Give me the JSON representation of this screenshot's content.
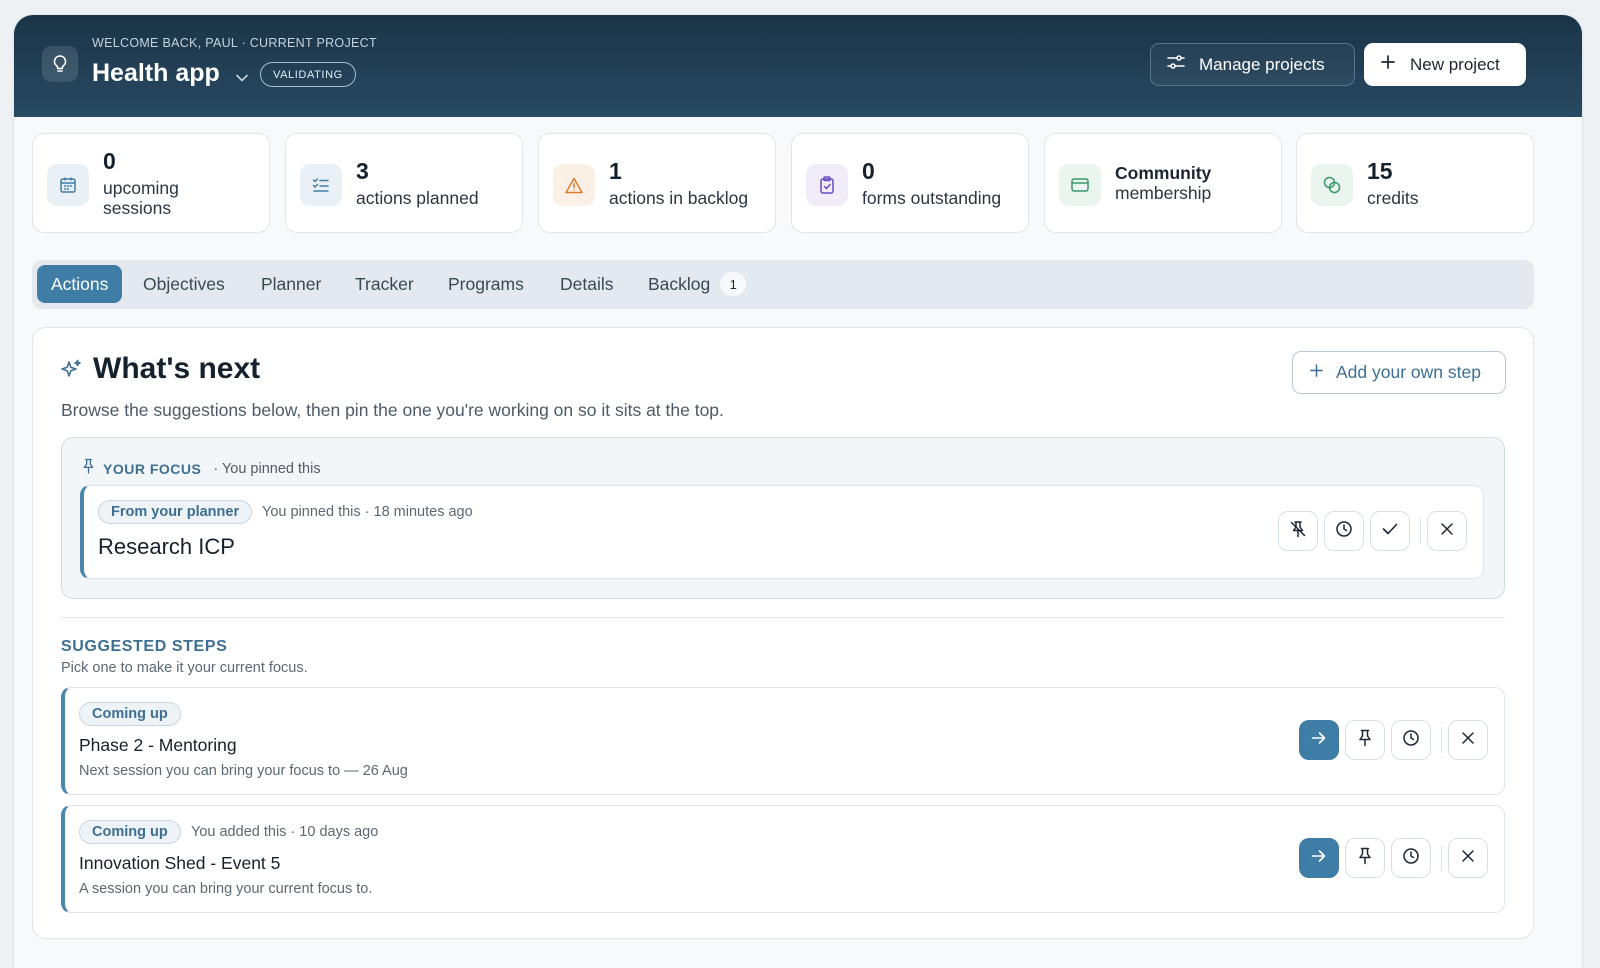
{
  "header": {
    "welcome": "WELCOME BACK, PAUL · CURRENT PROJECT",
    "project_title": "Health app",
    "status": "VALIDATING",
    "manage_label": "Manage projects",
    "new_label": "New project",
    "icons": {
      "project": "lightbulb-icon",
      "chevron": "chevron-down-icon",
      "manage": "sliders-icon",
      "new": "plus-icon"
    }
  },
  "stats": [
    {
      "number": "0",
      "label_line1": "upcoming",
      "label_line2": "sessions",
      "icon": "calendar-icon",
      "color": "#3f7da6"
    },
    {
      "number": "3",
      "label_line1": "actions planned",
      "icon": "checklist-icon",
      "color": "#3f7da6"
    },
    {
      "number": "1",
      "label_line1": "actions in backlog",
      "icon": "warning-icon",
      "color": "#e07b2e"
    },
    {
      "number": "0",
      "label_line1": "forms outstanding",
      "icon": "clipboard-icon",
      "color": "#6a4bc4"
    },
    {
      "label_line1": "Community",
      "label_line2": "membership",
      "icon": "card-icon",
      "color": "#3b9a6a"
    },
    {
      "number": "15",
      "label_line1": "credits",
      "icon": "coins-icon",
      "color": "#3b9a6a"
    }
  ],
  "tabs": [
    {
      "label": "Actions",
      "active": true
    },
    {
      "label": "Objectives"
    },
    {
      "label": "Planner"
    },
    {
      "label": "Tracker"
    },
    {
      "label": "Programs"
    },
    {
      "label": "Details"
    },
    {
      "label": "Backlog",
      "count": "1"
    }
  ],
  "main": {
    "title": "What's next",
    "add_step_label": "Add your own step",
    "description": "Browse the suggestions below, then pin the one you're working on so it sits at the top.",
    "focus": {
      "tag": "YOUR FOCUS",
      "sub": "· You pinned this",
      "card": {
        "pill": "From your planner",
        "meta": "You pinned this · 18 minutes ago",
        "title": "Research ICP"
      }
    },
    "suggested": {
      "title": "SUGGESTED STEPS",
      "subtitle": "Pick one to make it your current focus.",
      "items": [
        {
          "pill": "Coming up",
          "meta": "",
          "title": "Phase 2 - Mentoring",
          "desc": "Next session you can bring your focus to — 26 Aug"
        },
        {
          "pill": "Coming up",
          "meta": "You added this · 10 days ago",
          "title": "Innovation Shed - Event 5",
          "desc": "A session you can bring your current focus to."
        }
      ]
    }
  },
  "colors": {
    "accent": "#3f7da6",
    "header_dark": "#1b3346"
  }
}
